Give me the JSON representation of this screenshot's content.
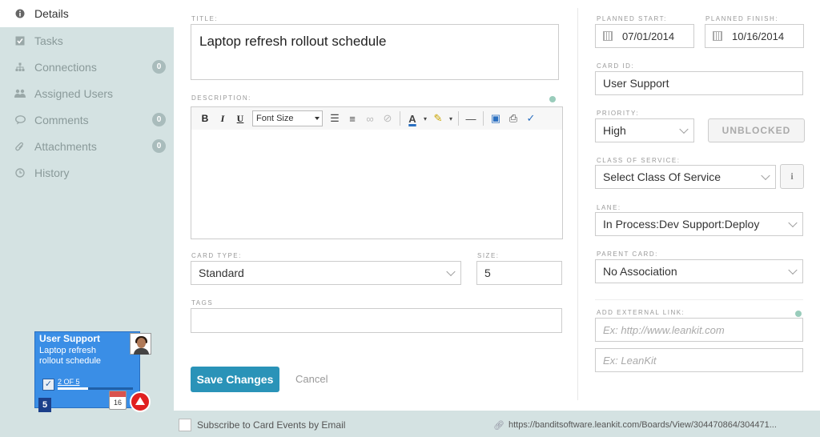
{
  "sidebar": {
    "items": [
      {
        "label": "Details",
        "icon": "info-circle-icon",
        "active": true
      },
      {
        "label": "Tasks",
        "icon": "checkbox-icon"
      },
      {
        "label": "Connections",
        "icon": "hierarchy-icon",
        "badge": "0"
      },
      {
        "label": "Assigned Users",
        "icon": "users-icon"
      },
      {
        "label": "Comments",
        "icon": "speech-bubble-icon",
        "badge": "0"
      },
      {
        "label": "Attachments",
        "icon": "paperclip-icon",
        "badge": "0"
      },
      {
        "label": "History",
        "icon": "clock-icon"
      }
    ]
  },
  "card_preview": {
    "lane": "User Support",
    "title": "Laptop refresh rollout schedule",
    "tasks_progress": "2 OF 5",
    "tasks_fraction": 0.4,
    "size": "5",
    "calendar_day": "16",
    "color": "#3a8ee6"
  },
  "form": {
    "title_label": "TITLE:",
    "title_value": "Laptop refresh rollout schedule",
    "description_label": "DESCRIPTION:",
    "toolbar": {
      "bold": "B",
      "italic": "I",
      "underline": "U",
      "font_size": "Font Size"
    },
    "card_type_label": "CARD TYPE:",
    "card_type_value": "Standard",
    "size_label": "SIZE:",
    "size_value": "5",
    "tags_label": "TAGS",
    "save_label": "Save Changes",
    "cancel_label": "Cancel",
    "planned_start_label": "PLANNED START:",
    "planned_start_value": "07/01/2014",
    "planned_finish_label": "PLANNED FINISH:",
    "planned_finish_value": "10/16/2014",
    "card_id_label": "CARD ID:",
    "card_id_value": "User Support",
    "priority_label": "PRIORITY:",
    "priority_value": "High",
    "blocked_label": "UNBLOCKED",
    "class_label": "CLASS OF SERVICE:",
    "class_value": "Select Class Of Service",
    "info_label": "i",
    "lane_label": "LANE:",
    "lane_value": "In Process:Dev Support:Deploy",
    "parent_label": "PARENT CARD:",
    "parent_value": "No Association",
    "ext_link_label": "ADD EXTERNAL LINK:",
    "ext_link_url_placeholder": "Ex: http://www.leankit.com",
    "ext_link_name_placeholder": "Ex: LeanKit"
  },
  "footer": {
    "subscribe_label": "Subscribe to Card Events by Email",
    "card_url": "https://banditsoftware.leankit.com/Boards/View/304470864/304471..."
  },
  "colors": {
    "accent": "#2a93b8",
    "sidebar_bg": "#d4e2e2",
    "card_blue": "#3a8ee6"
  }
}
